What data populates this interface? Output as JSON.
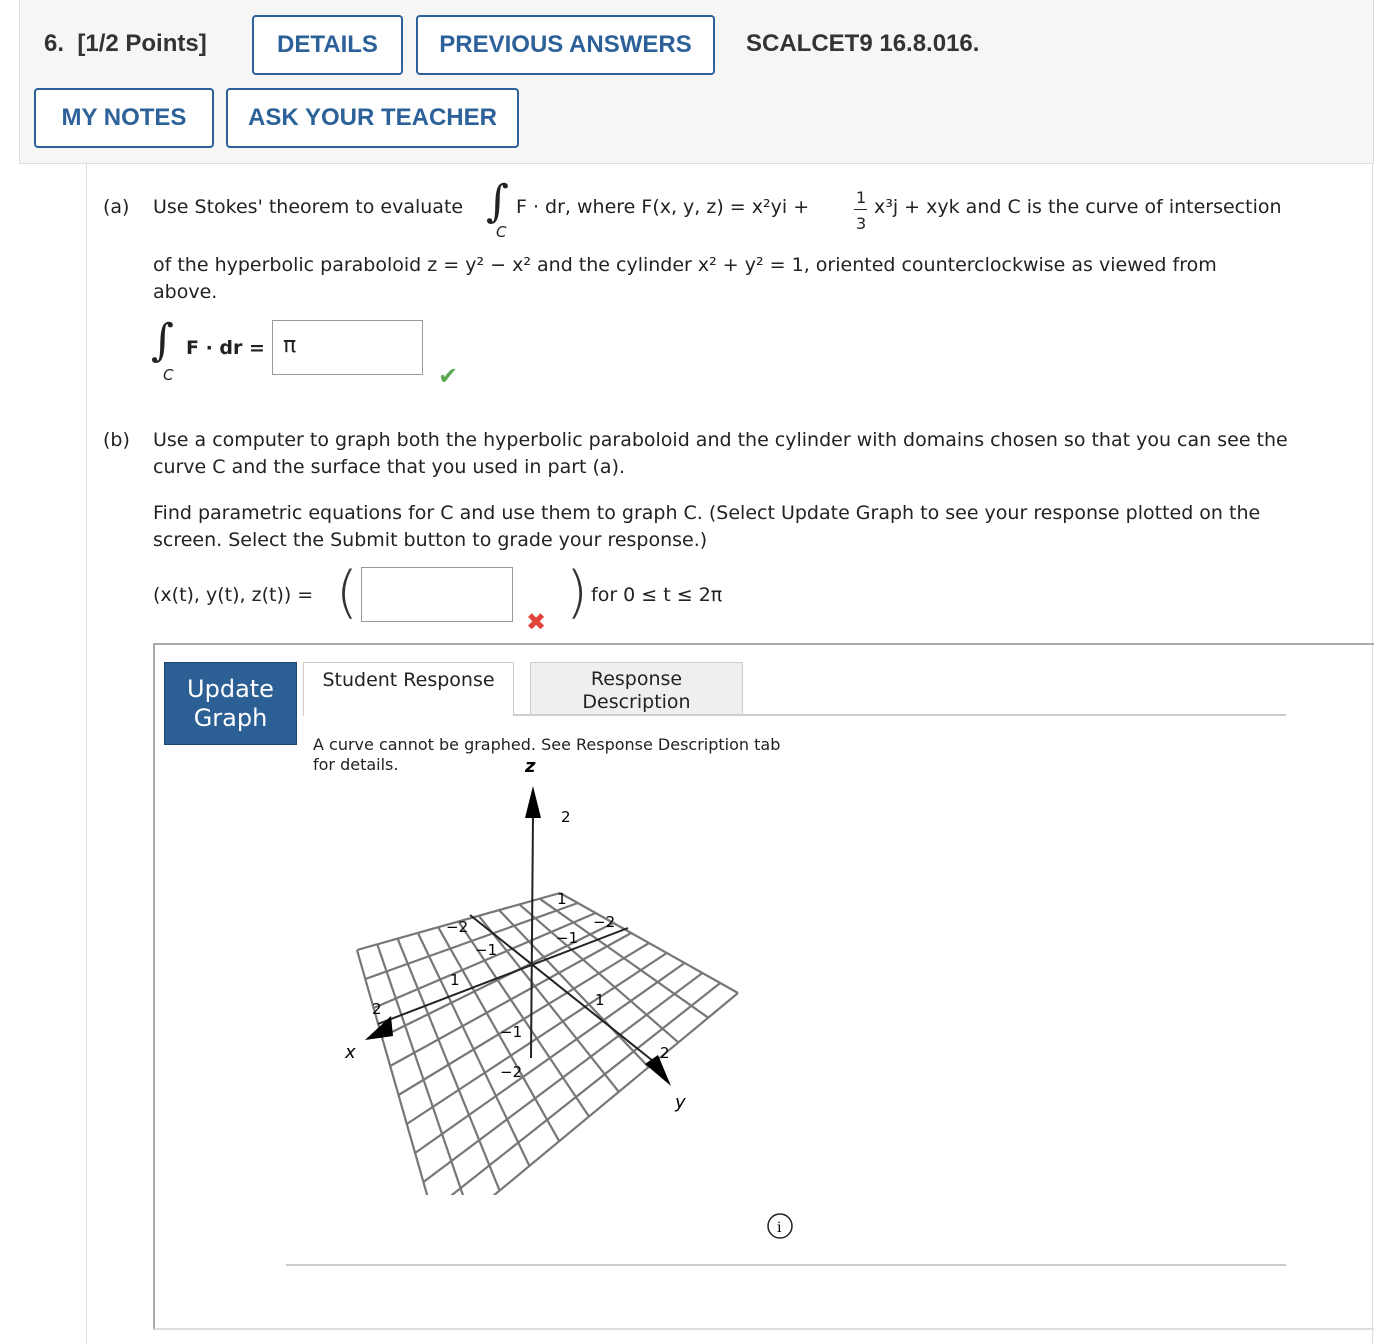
{
  "header": {
    "question_number": "6.",
    "points": "[1/2 Points]",
    "details_button": "DETAILS",
    "previous_answers_button": "PREVIOUS ANSWERS",
    "problem_code": "SCALCET9 16.8.016.",
    "my_notes_button": "MY NOTES",
    "ask_teacher_button": "ASK YOUR TEACHER"
  },
  "part_a": {
    "label": "(a)",
    "text_line1_start": "Use Stokes' theorem to evaluate",
    "integral_sub": "C",
    "text_line1_mid": "F · dr, where F(x, y, z) = x²yi + ",
    "frac_num": "1",
    "frac_den": "3",
    "text_line1_end": "x³j + xyk and C is the curve of intersection",
    "text_line2": "of the hyperbolic paraboloid z = y² − x² and the cylinder x² + y² = 1, oriented counterclockwise as viewed from",
    "text_line3": "above.",
    "answer_lhs": "F · dr =",
    "answer_value": "π",
    "answer_status": "correct"
  },
  "part_b": {
    "label": "(b)",
    "text_line1": "Use a computer to graph both the hyperbolic paraboloid and the cylinder with domains chosen so that you can see the",
    "text_line2": "curve C and the surface that you used in part (a).",
    "text_line3": "Find parametric equations for C and use them to graph C. (Select Update Graph to see your response plotted on the",
    "text_line4": "screen. Select the Submit button to grade your response.)",
    "param_lhs": "(x(t), y(t), z(t)) =",
    "param_value": "",
    "param_status": "incorrect",
    "param_domain": "for 0 ≤ t ≤ 2π"
  },
  "graph": {
    "update_button": "Update Graph",
    "tabs": [
      {
        "label": "Student Response",
        "active": true
      },
      {
        "label": "Response Description",
        "active": false
      }
    ],
    "message": "A curve cannot be graphed. See Response Description tab",
    "message_line2": "for details.",
    "axes": {
      "x": "x",
      "y": "y",
      "z": "z"
    },
    "ticks": [
      "2",
      "1",
      "−1",
      "−2"
    ],
    "info_icon": "info-icon"
  },
  "colors": {
    "accent": "#2d6199",
    "correct": "#5aa854",
    "incorrect": "#e0443a"
  }
}
